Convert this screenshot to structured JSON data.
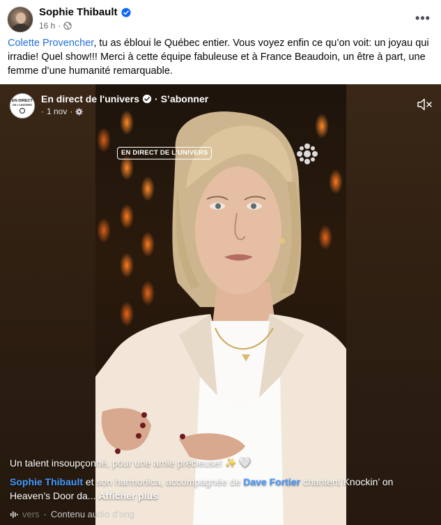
{
  "post": {
    "author": "Sophie Thibault",
    "time": "16 h",
    "meta_sep": "·",
    "more": "•••",
    "text": {
      "mention": "Colette Provencher",
      "body": ", tu as ébloui le Québec entier. Vous voyez enfin ce qu’on voit: un joyau qui irradie! Quel show!!! Merci à cette équipe fabuleuse et à France Beaudoin, un être à part,  une femme d’une humanité remarquable."
    }
  },
  "video": {
    "page_avatar_lines": [
      "EN DIRECT",
      "DE L'UNIVERS"
    ],
    "page_name": "En direct de l'univers",
    "separator": "·",
    "subscribe": "S’abonner",
    "page_meta_prefix": "·",
    "page_date": "1 nov",
    "page_meta_sep": "·",
    "live_badge": "EN DIRECT DE L'UNIVERS",
    "caption": {
      "line1": "Un talent insoupçonné, pour une amie précieuse!",
      "sparkle": "✨",
      "heart": "🤍",
      "mention1": "Sophie Thibault",
      "part1": " et son harmonica, accompagnée de ",
      "mention2": "Dave Fortier",
      "part2": " chantent Knockin’ on Heaven’s Door da... ",
      "see_more": "Afficher plus"
    },
    "audio": {
      "faded": "vers",
      "sep": "·",
      "label": "Contenu audio d’orig"
    }
  },
  "colors": {
    "link": "#216fdb",
    "caption_link": "#4599ff",
    "meta": "#65676b",
    "verified": "#0866ff"
  },
  "icons": [
    "verified-badge-icon",
    "globe-icon",
    "more-options-icon",
    "gear-icon",
    "mute-icon",
    "sparkle-icon",
    "heart-icon",
    "audio-wave-icon"
  ]
}
